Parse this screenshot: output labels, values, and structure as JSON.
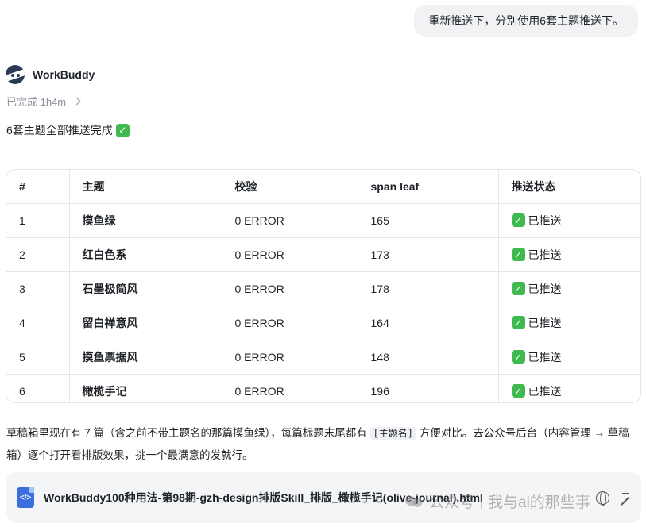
{
  "user_message": "重新推送下，分别使用6套主题推送下。",
  "assistant": {
    "name": "WorkBuddy",
    "status": "已完成 1h4m",
    "intro": "6套主题全部推送完成",
    "intro_emoji": "✓"
  },
  "table": {
    "headers": [
      "#",
      "主题",
      "校验",
      "span leaf",
      "推送状态"
    ],
    "rows": [
      {
        "num": "1",
        "theme": "摸鱼绿",
        "check": "0 ERROR",
        "span": "165",
        "status": "已推送"
      },
      {
        "num": "2",
        "theme": "红白色系",
        "check": "0 ERROR",
        "span": "173",
        "status": "已推送"
      },
      {
        "num": "3",
        "theme": "石墨极简风",
        "check": "0 ERROR",
        "span": "178",
        "status": "已推送"
      },
      {
        "num": "4",
        "theme": "留白禅意风",
        "check": "0 ERROR",
        "span": "164",
        "status": "已推送"
      },
      {
        "num": "5",
        "theme": "摸鱼票据风",
        "check": "0 ERROR",
        "span": "148",
        "status": "已推送"
      },
      {
        "num": "6",
        "theme": "橄榄手记",
        "check": "0 ERROR",
        "span": "196",
        "status": "已推送"
      }
    ]
  },
  "summary": {
    "part1": "草稿箱里现在有 7 篇（含之前不带主题名的那篇摸鱼绿），每篇标题末尾都有 ",
    "tag": "[主题名]",
    "part2": " 方便对比。去公众号后台（内容管理 → 草稿箱）逐个打开看排版效果，挑一个最满意的发就行。"
  },
  "file_card": {
    "name": "WorkBuddy100种用法-第98期-gzh-design排版Skill_排版_橄榄手记(olive-journal).html"
  },
  "watermark": {
    "left": "公众号",
    "right": "我与ai的那些事"
  }
}
